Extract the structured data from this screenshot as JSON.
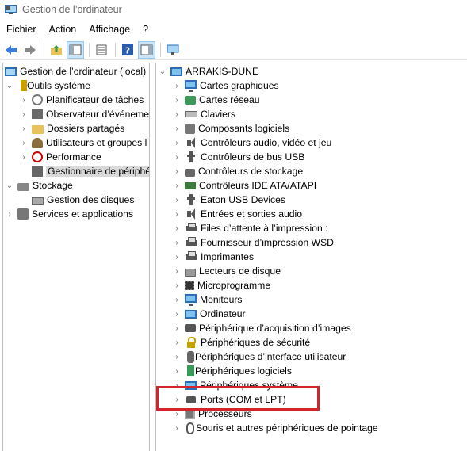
{
  "window": {
    "title": "Gestion de l’ordinateur"
  },
  "menu": [
    "Fichier",
    "Action",
    "Affichage",
    "?"
  ],
  "toolbar": [
    {
      "icon": "back-arrow-icon"
    },
    {
      "icon": "forward-arrow-icon"
    },
    {
      "icon": "up-folder-icon"
    },
    {
      "icon": "console-tree-icon",
      "active": true
    },
    {
      "icon": "properties-icon"
    },
    {
      "icon": "help-icon"
    },
    {
      "icon": "action-pane-icon",
      "active": true
    },
    {
      "icon": "scan-hardware-icon"
    }
  ],
  "left_tree": {
    "root": "Gestion de l’ordinateur (local)",
    "system_tools": "Outils système",
    "system_items": [
      "Planificateur de tâches",
      "Observateur d’événeme",
      "Dossiers partagés",
      "Utilisateurs et groupes l",
      "Performance",
      "Gestionnaire de périphé"
    ],
    "storage": "Stockage",
    "disk_mgmt": "Gestion des disques",
    "services": "Services et applications"
  },
  "device_tree": {
    "computer": "ARRAKIS-DUNE",
    "categories": [
      "Cartes graphiques",
      "Cartes réseau",
      "Claviers",
      "Composants logiciels",
      "Contrôleurs audio, vidéo et jeu",
      "Contrôleurs de bus USB",
      "Contrôleurs de stockage",
      "Contrôleurs IDE ATA/ATAPI",
      "Eaton USB Devices",
      "Entrées et sorties audio",
      "Files d’attente à l’impression :",
      "Fournisseur d’impression WSD",
      "Imprimantes",
      "Lecteurs de disque",
      "Microprogramme",
      "Moniteurs",
      "Ordinateur",
      "Périphérique d’acquisition d’images",
      "Périphériques de sécurité",
      "Périphériques d’interface utilisateur",
      "Périphériques logiciels",
      "Périphériques système",
      "Ports (COM et LPT)",
      "Processeurs",
      "Souris et autres périphériques de pointage"
    ]
  },
  "colors": {
    "highlight": "#d4232c",
    "selection": "#d9d9d9"
  }
}
